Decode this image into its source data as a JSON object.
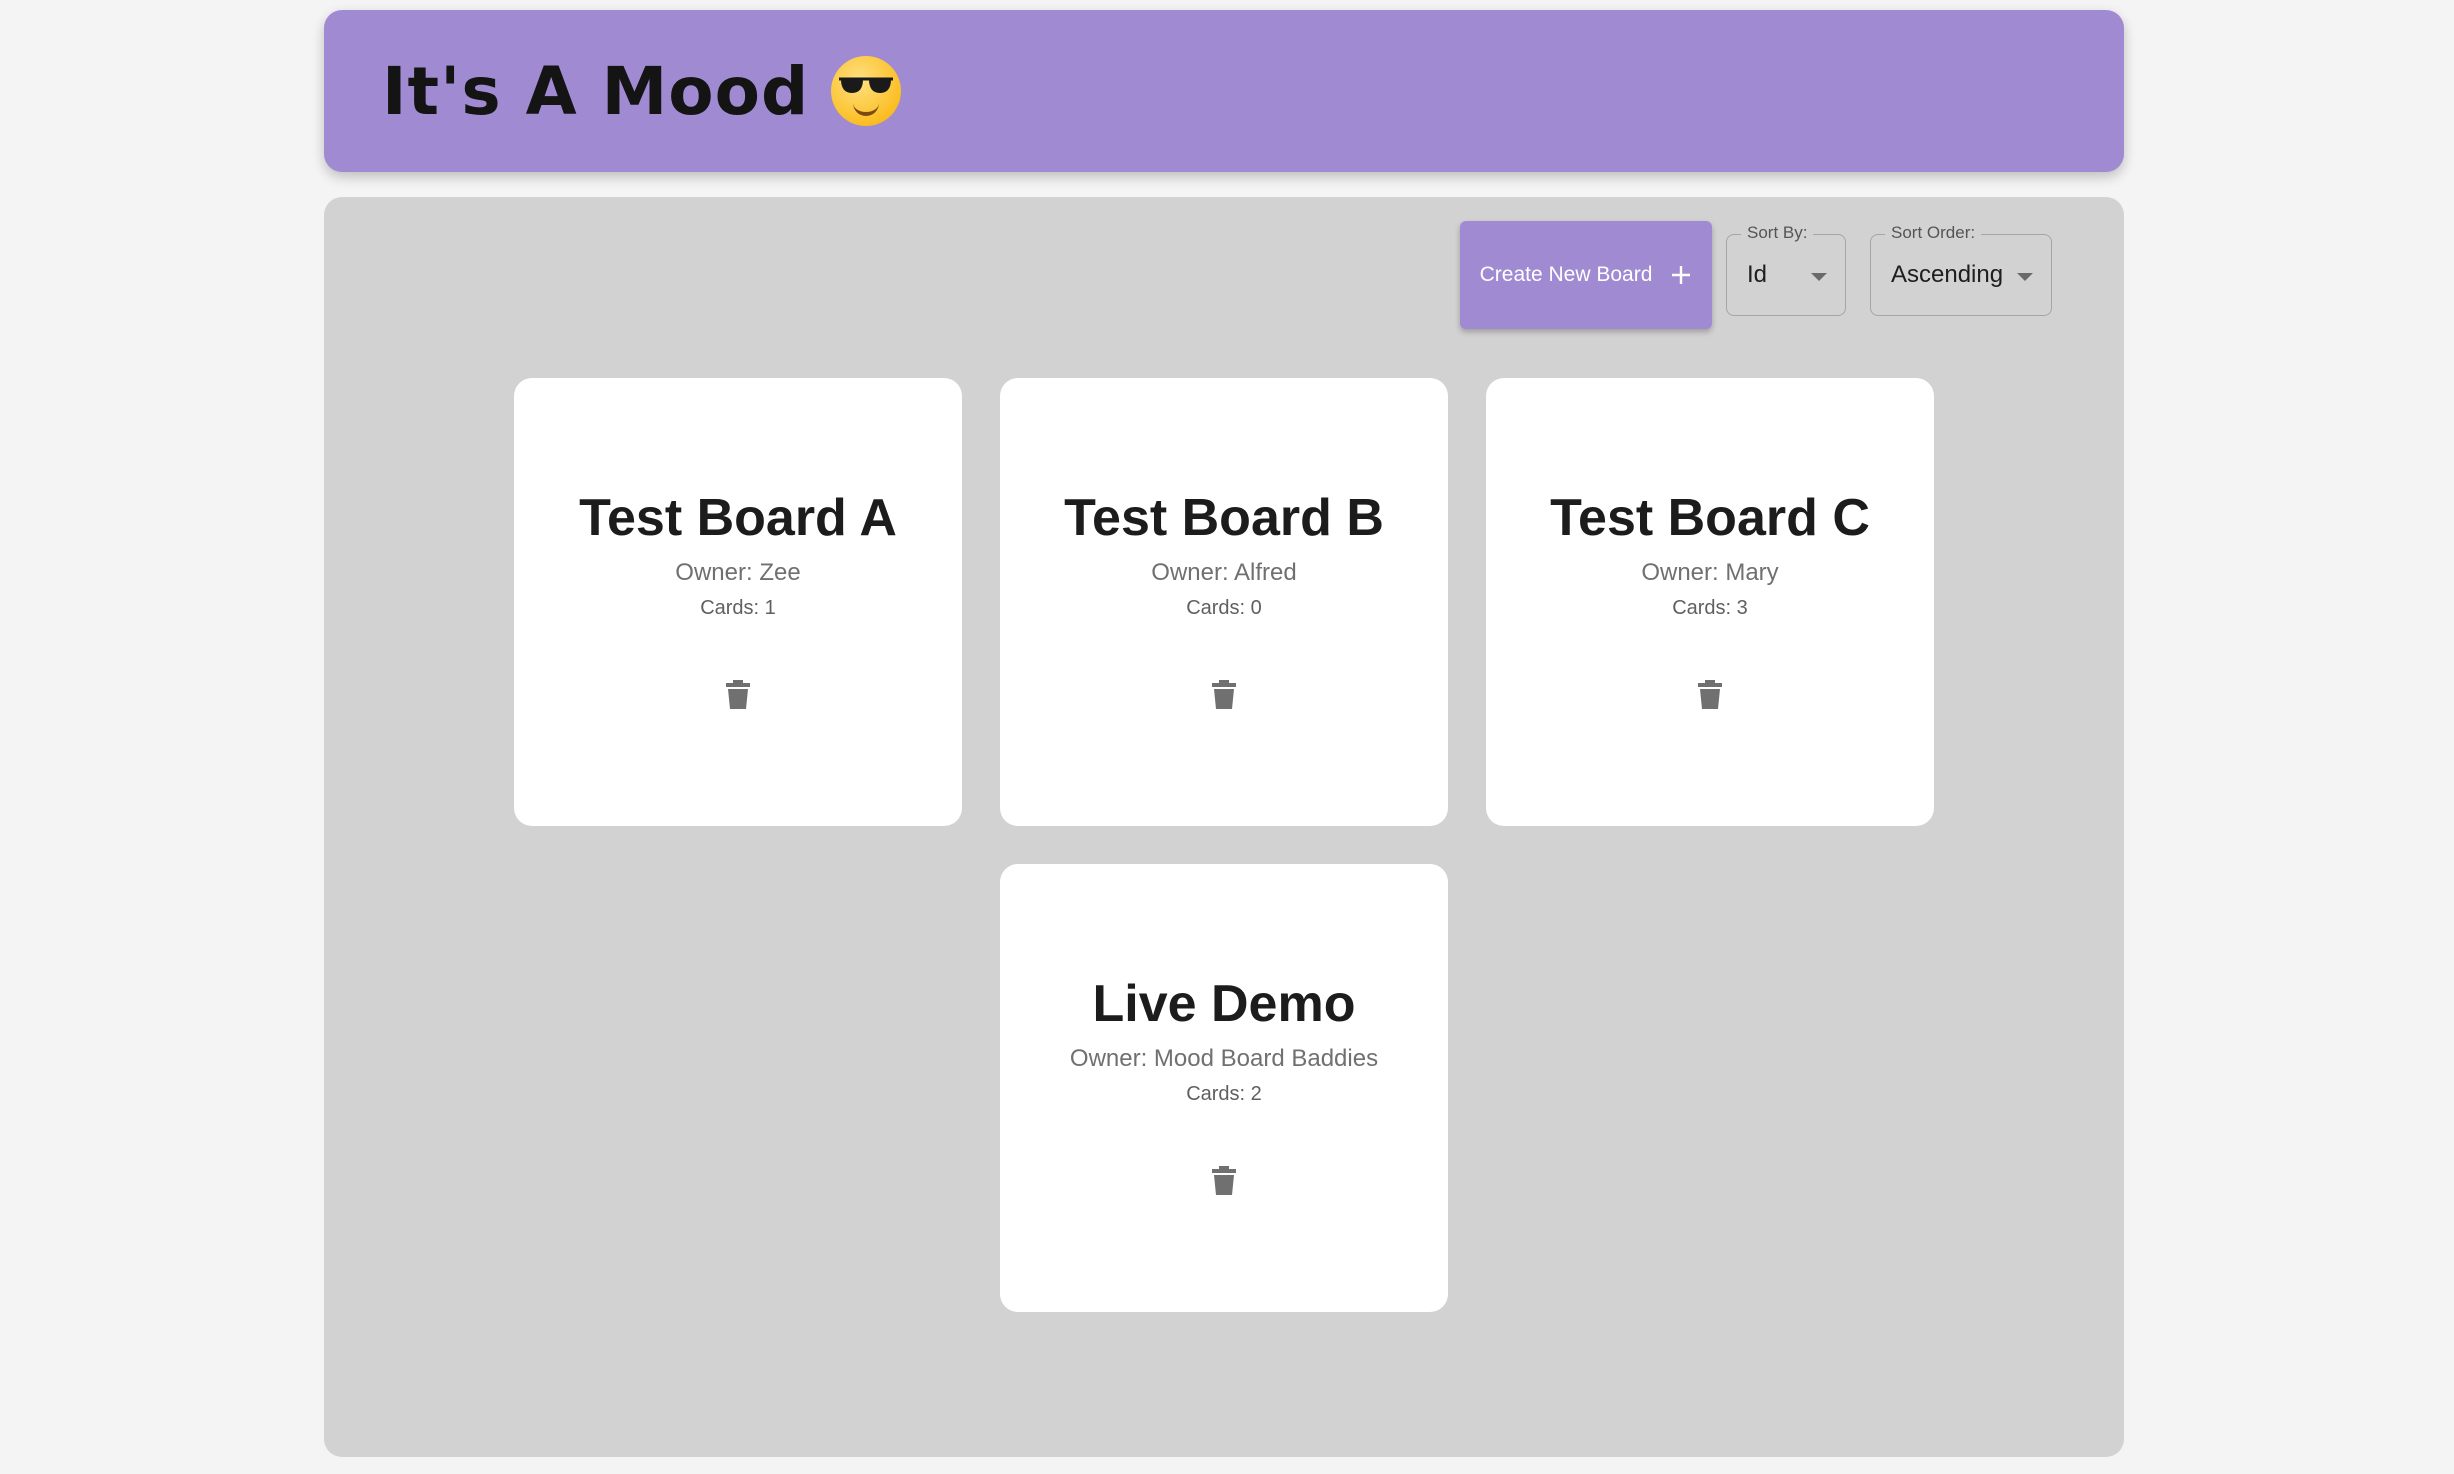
{
  "header": {
    "title": "It's A Mood",
    "emoji_icon": "sunglasses-smiley-icon"
  },
  "toolbar": {
    "create_label": "Create New Board",
    "create_icon": "plus-icon",
    "sort_by": {
      "label": "Sort By:",
      "value": "Id"
    },
    "sort_order": {
      "label": "Sort Order:",
      "value": "Ascending"
    }
  },
  "boards": [
    {
      "title": "Test Board A",
      "owner": "Owner: Zee",
      "cards": "Cards: 1"
    },
    {
      "title": "Test Board B",
      "owner": "Owner: Alfred",
      "cards": "Cards: 0"
    },
    {
      "title": "Test Board C",
      "owner": "Owner: Mary",
      "cards": "Cards: 3"
    },
    {
      "title": "Live Demo",
      "owner": "Owner: Mood Board Baddies",
      "cards": "Cards: 2"
    }
  ],
  "colors": {
    "accent": "#a08ad2",
    "panel": "#d3d2d3",
    "background": "#f4f4f4"
  }
}
